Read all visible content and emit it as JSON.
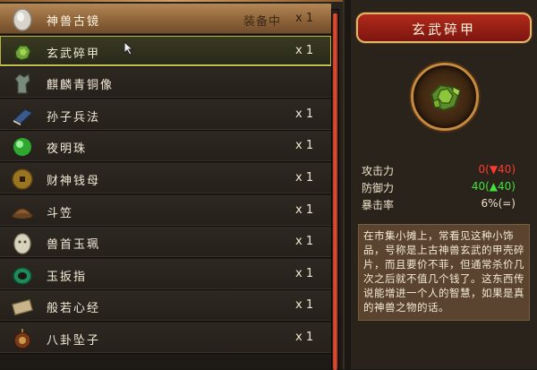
{
  "list": {
    "items": [
      {
        "name": "神兽古镜",
        "status": "装备中",
        "qty": "x 1",
        "icon": "ancient-mirror-icon"
      },
      {
        "name": "玄武碎甲",
        "status": "",
        "qty": "x 1",
        "icon": "turtle-shell-icon"
      },
      {
        "name": "麒麟青铜像",
        "status": "",
        "qty": "",
        "icon": "bronze-statue-icon"
      },
      {
        "name": "孙子兵法",
        "status": "",
        "qty": "x 1",
        "icon": "book-icon"
      },
      {
        "name": "夜明珠",
        "status": "",
        "qty": "x 1",
        "icon": "green-pearl-icon"
      },
      {
        "name": "财神钱母",
        "status": "",
        "qty": "x 1",
        "icon": "coin-icon"
      },
      {
        "name": "斗笠",
        "status": "",
        "qty": "x 1",
        "icon": "straw-hat-icon"
      },
      {
        "name": "兽首玉珮",
        "status": "",
        "qty": "x 1",
        "icon": "jade-pendant-icon"
      },
      {
        "name": "玉扳指",
        "status": "",
        "qty": "x 1",
        "icon": "jade-ring-icon"
      },
      {
        "name": "般若心经",
        "status": "",
        "qty": "x 1",
        "icon": "scroll-icon"
      },
      {
        "name": "八卦坠子",
        "status": "",
        "qty": "x 1",
        "icon": "bagua-pendant-icon"
      }
    ]
  },
  "detail": {
    "title": "玄武碎甲",
    "stats": [
      {
        "label": "攻击力",
        "value": "0(▼40)",
        "color": "#ff3b2f"
      },
      {
        "label": "防御力",
        "value": "40(▲40)",
        "color": "#42e23a"
      },
      {
        "label": "暴击率",
        "value": "6%(=)",
        "color": "#f0e2c8"
      }
    ],
    "description": "在市集小摊上，常看见这种小饰品，号称是上古神兽玄武的甲壳碎片，而且要价不菲，但通常杀价几次之后就不值几个钱了。这东西传说能增进一个人的智慧，如果是真的神兽之物的话。"
  },
  "colors": {
    "equipped_row": "#b48756",
    "selected_row_border": "#d6d55c",
    "title_bar": "#b12a1a",
    "scroll_thumb": "#e0553a"
  }
}
